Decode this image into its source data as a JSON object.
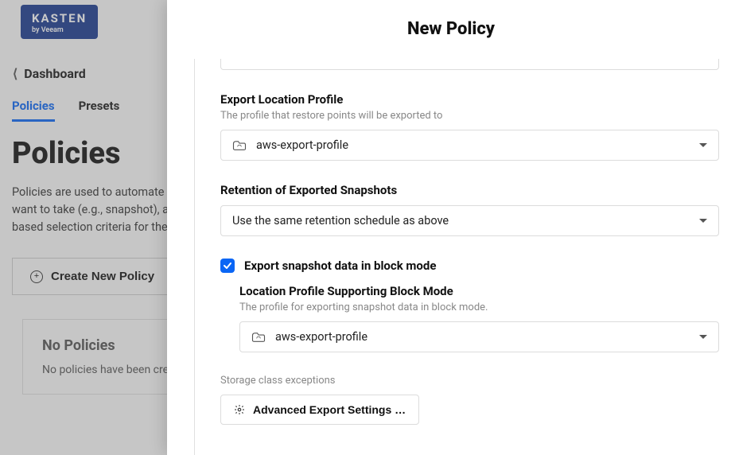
{
  "brand": {
    "main": "KASTEN",
    "sub": "by Veeam"
  },
  "breadcrumb": {
    "label": "Dashboard"
  },
  "tabs": {
    "policies": "Policies",
    "presets": "Presets"
  },
  "page": {
    "title": "Policies",
    "description": "Policies are used to automate your data management workflows. To achieve this, they combine actions you want to take (e.g., snapshot), a frequency or schedule for how often you want to take that action, and a label-based selection criteria for the resources you want to manage."
  },
  "createButton": "Create New Policy",
  "empty": {
    "title": "No Policies",
    "subtitle": "No policies have been created yet."
  },
  "modal": {
    "title": "New Policy",
    "exportLocation": {
      "label": "Export Location Profile",
      "help": "The profile that restore points will be exported to",
      "value": "aws-export-profile"
    },
    "retention": {
      "label": "Retention of Exported Snapshots",
      "value": "Use the same retention schedule as above"
    },
    "blockMode": {
      "checkboxLabel": "Export snapshot data in block mode",
      "checked": true,
      "profileLabel": "Location Profile Supporting Block Mode",
      "profileHelp": "The profile for exporting snapshot data in block mode.",
      "profileValue": "aws-export-profile"
    },
    "storageExceptions": "Storage class exceptions",
    "advancedButton": "Advanced Export Settings …"
  }
}
